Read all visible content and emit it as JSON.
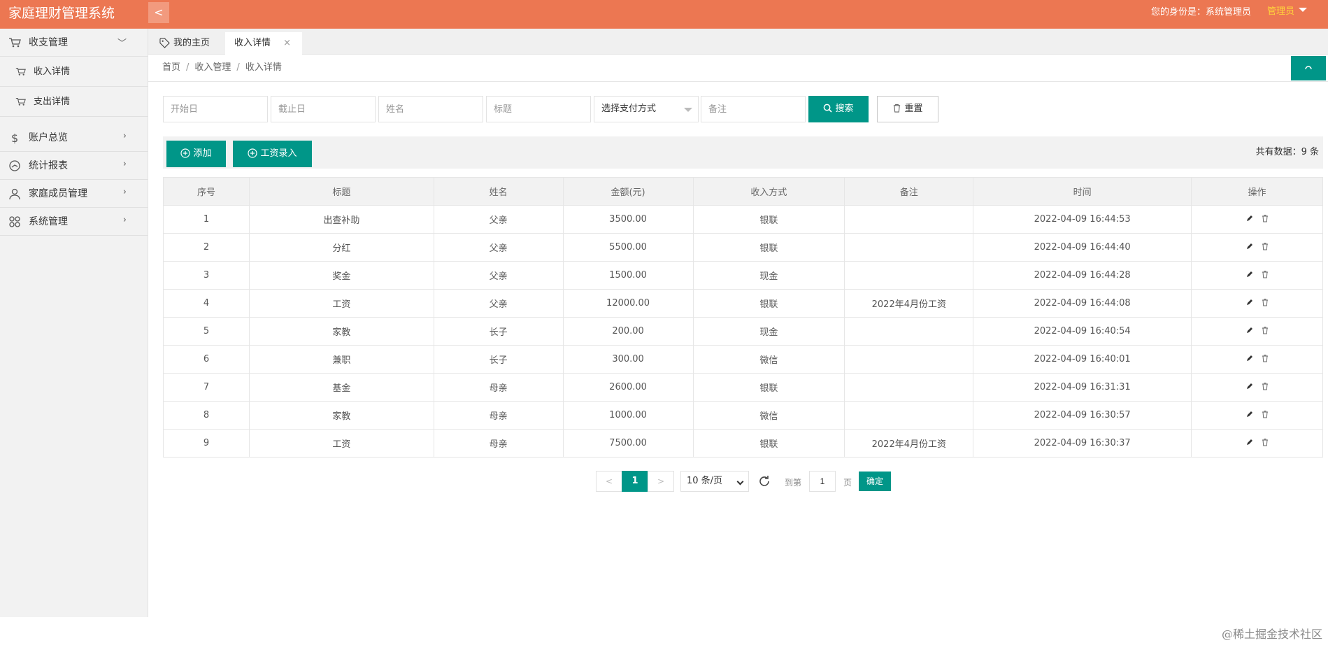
{
  "app": {
    "title": "家庭理财管理系统",
    "collapse_glyph": "<",
    "identity": "您的身份是：系统管理员",
    "role_menu": "管理员"
  },
  "sidebar": {
    "group": {
      "label": "收支管理",
      "icon": "cart-icon"
    },
    "sub_items": [
      {
        "label": "收入详情",
        "icon": "cart-icon"
      },
      {
        "label": "支出详情",
        "icon": "cart-icon"
      }
    ],
    "items": [
      {
        "label": "账户总览",
        "icon": "dollar-icon"
      },
      {
        "label": "统计报表",
        "icon": "gauge-icon"
      },
      {
        "label": "家庭成员管理",
        "icon": "user-icon"
      },
      {
        "label": "系统管理",
        "icon": "grid-icon"
      }
    ]
  },
  "tabs": {
    "home": "我的主页",
    "active": "收入详情",
    "close_glyph": "×"
  },
  "breadcrumb": [
    "首页",
    "收入管理",
    "收入详情"
  ],
  "breadcrumb_sep": "/",
  "search": {
    "start_date_placeholder": "开始日",
    "end_date_placeholder": "截止日",
    "name_placeholder": "姓名",
    "title_placeholder": "标题",
    "payment_select": "选择支付方式",
    "remark_placeholder": "备注",
    "search_label": "搜索",
    "reset_label": "重置"
  },
  "toolbar": {
    "add_label": "添加",
    "salary_label": "工资录入",
    "total_text": "共有数据：9 条"
  },
  "table": {
    "columns": [
      "序号",
      "标题",
      "姓名",
      "金额(元)",
      "收入方式",
      "备注",
      "时间",
      "操作"
    ],
    "rows": [
      [
        "1",
        "出查补助",
        "父亲",
        "3500.00",
        "银联",
        "",
        "2022-04-09 16:44:53"
      ],
      [
        "2",
        "分红",
        "父亲",
        "5500.00",
        "银联",
        "",
        "2022-04-09 16:44:40"
      ],
      [
        "3",
        "奖金",
        "父亲",
        "1500.00",
        "现金",
        "",
        "2022-04-09 16:44:28"
      ],
      [
        "4",
        "工资",
        "父亲",
        "12000.00",
        "银联",
        "2022年4月份工资",
        "2022-04-09 16:44:08"
      ],
      [
        "5",
        "家教",
        "长子",
        "200.00",
        "现金",
        "",
        "2022-04-09 16:40:54"
      ],
      [
        "6",
        "兼职",
        "长子",
        "300.00",
        "微信",
        "",
        "2022-04-09 16:40:01"
      ],
      [
        "7",
        "基金",
        "母亲",
        "2600.00",
        "银联",
        "",
        "2022-04-09 16:31:31"
      ],
      [
        "8",
        "家教",
        "母亲",
        "1000.00",
        "微信",
        "",
        "2022-04-09 16:30:57"
      ],
      [
        "9",
        "工资",
        "母亲",
        "7500.00",
        "银联",
        "2022年4月份工资",
        "2022-04-09 16:30:37"
      ]
    ]
  },
  "pager": {
    "prev": "<",
    "current": "1",
    "next": ">",
    "page_size": "10 条/页",
    "goto_label": "到第",
    "goto_value": "1",
    "page_unit": "页",
    "confirm": "确定"
  },
  "credit": "@稀土掘金技术社区",
  "colors": {
    "header": "#ec7752",
    "primary": "#009688",
    "role": "#ffd43b"
  }
}
